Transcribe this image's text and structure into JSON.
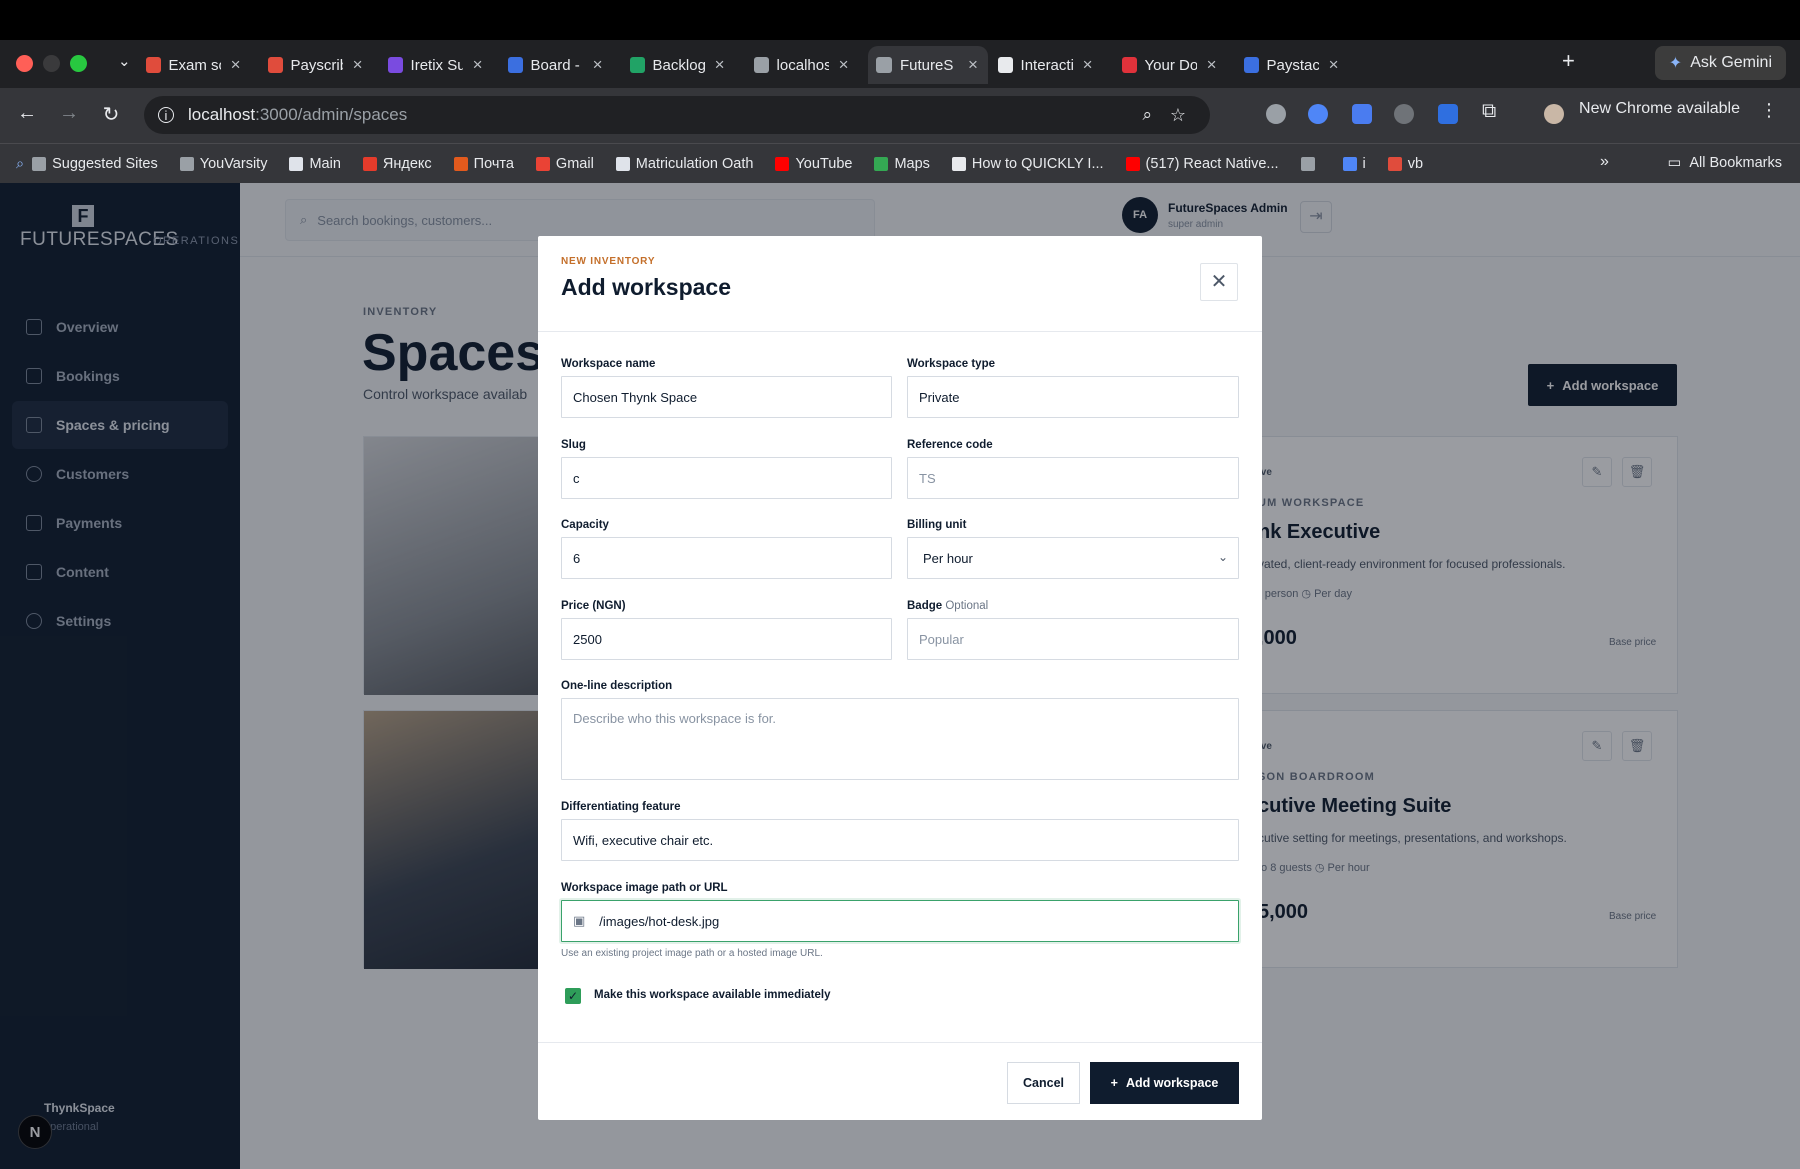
{
  "browser": {
    "tabs": [
      {
        "label": "Exam so",
        "color": "#e04c3c"
      },
      {
        "label": "Payscrib",
        "color": "#e04c3c"
      },
      {
        "label": "Iretix Su",
        "color": "#7a4be0"
      },
      {
        "label": "Board -",
        "color": "#3b6fe0"
      },
      {
        "label": "Backlog",
        "color": "#21a366"
      },
      {
        "label": "localhos",
        "color": "#9aa0a6"
      },
      {
        "label": "FutureS",
        "color": "#9aa0a6"
      },
      {
        "label": "Interacti",
        "color": "#e8eaed"
      },
      {
        "label": "Your Do",
        "color": "#e0323b"
      },
      {
        "label": "Paystac",
        "color": "#3b6fe0"
      }
    ],
    "gemini": "Ask Gemini",
    "url_host": "localhost",
    "url_path": ":3000/admin/spaces",
    "new_chrome": "New Chrome available",
    "bookmarks": [
      "Suggested Sites",
      "YouVarsity",
      "Main",
      "Яндекс",
      "Почта",
      "Gmail",
      "Matriculation Oath",
      "YouTube",
      "Maps",
      "How to QUICKLY I...",
      "(517) React Native...",
      "",
      "i",
      "vb"
    ],
    "all_bookmarks": "All Bookmarks"
  },
  "sidebar": {
    "brand": "FUTURESPACES",
    "brand_tag": "OPERATIONS",
    "items": [
      {
        "label": "Overview"
      },
      {
        "label": "Bookings"
      },
      {
        "label": "Spaces & pricing"
      },
      {
        "label": "Customers"
      },
      {
        "label": "Payments"
      },
      {
        "label": "Content"
      },
      {
        "label": "Settings"
      }
    ],
    "footer_name": "ThynkSpace",
    "footer_status": "operational",
    "n_badge": "N"
  },
  "topbar": {
    "search_placeholder": "Search bookings, customers...",
    "avatar": "FA",
    "admin_name": "FutureSpaces Admin",
    "admin_role": "super admin"
  },
  "page": {
    "eyebrow": "INVENTORY",
    "title": "Spaces",
    "subtitle": "Control workspace availab",
    "add_button": "Add workspace",
    "cards": [
      {
        "status": "ive",
        "kind": "UM WORKSPACE",
        "name": "nk Executive",
        "desc": "vated, client-ready environment for focused professionals.",
        "meta": "r person   ◷ Per day",
        "price": ",000",
        "base": "Base price"
      },
      {
        "status": "ive",
        "kind": "SON BOARDROOM",
        "name": "cutive Meeting Suite",
        "desc": "cutive setting for meetings, presentations, and workshops.",
        "meta": "to 8 guests   ◷ Per hour",
        "price": "5,000",
        "base": "Base price"
      }
    ]
  },
  "modal": {
    "eyebrow": "NEW INVENTORY",
    "title": "Add workspace",
    "fields": {
      "name_label": "Workspace name",
      "name_value": "Chosen Thynk Space",
      "type_label": "Workspace type",
      "type_value": "Private",
      "slug_label": "Slug",
      "slug_value": "c",
      "ref_label": "Reference code",
      "ref_placeholder": "TS",
      "capacity_label": "Capacity",
      "capacity_value": "6",
      "billing_label": "Billing unit",
      "billing_value": "Per hour",
      "price_label": "Price (NGN)",
      "price_value": "2500",
      "badge_label": "Badge",
      "badge_optional": "Optional",
      "badge_placeholder": "Popular",
      "desc_label": "One-line description",
      "desc_placeholder": "Describe who this workspace is for.",
      "feature_label": "Differentiating feature",
      "feature_value": "Wifi, executive chair etc.",
      "image_label": "Workspace image path or URL",
      "image_value": "/images/hot-desk.jpg",
      "image_help": "Use an existing project image path or a hosted image URL."
    },
    "available_label": "Make this workspace available immediately",
    "available_checked": true,
    "cancel": "Cancel",
    "submit": "Add workspace"
  }
}
